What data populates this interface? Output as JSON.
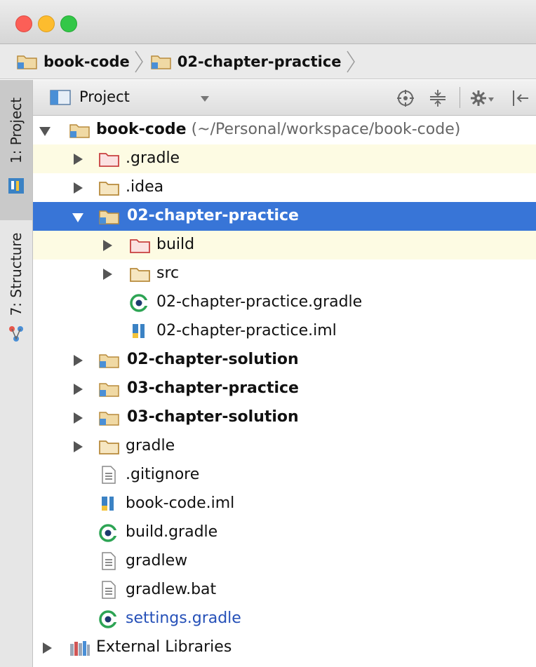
{
  "breadcrumb": {
    "items": [
      "book-code",
      "02-chapter-practice"
    ]
  },
  "sidebar": {
    "tabs": [
      {
        "label": "1: Project",
        "mnemonic": "1"
      },
      {
        "label": "7: Structure",
        "mnemonic": "7"
      }
    ]
  },
  "project_panel": {
    "view_selector": "Project"
  },
  "tree": {
    "root_name": "book-code",
    "root_path": "(~/Personal/workspace/book-code)",
    "items": [
      {
        "label": ".gradle"
      },
      {
        "label": ".idea"
      },
      {
        "label": "02-chapter-practice"
      },
      {
        "label": "build"
      },
      {
        "label": "src"
      },
      {
        "label": "02-chapter-practice.gradle"
      },
      {
        "label": "02-chapter-practice.iml"
      },
      {
        "label": "02-chapter-solution"
      },
      {
        "label": "03-chapter-practice"
      },
      {
        "label": "03-chapter-solution"
      },
      {
        "label": "gradle"
      },
      {
        "label": ".gitignore"
      },
      {
        "label": "book-code.iml"
      },
      {
        "label": "build.gradle"
      },
      {
        "label": "gradlew"
      },
      {
        "label": "gradlew.bat"
      },
      {
        "label": "settings.gradle"
      },
      {
        "label": "External Libraries"
      }
    ]
  },
  "colors": {
    "selection": "#3875d7",
    "excluded_highlight": "#fdfbe3",
    "settings_link": "#2550b8"
  }
}
